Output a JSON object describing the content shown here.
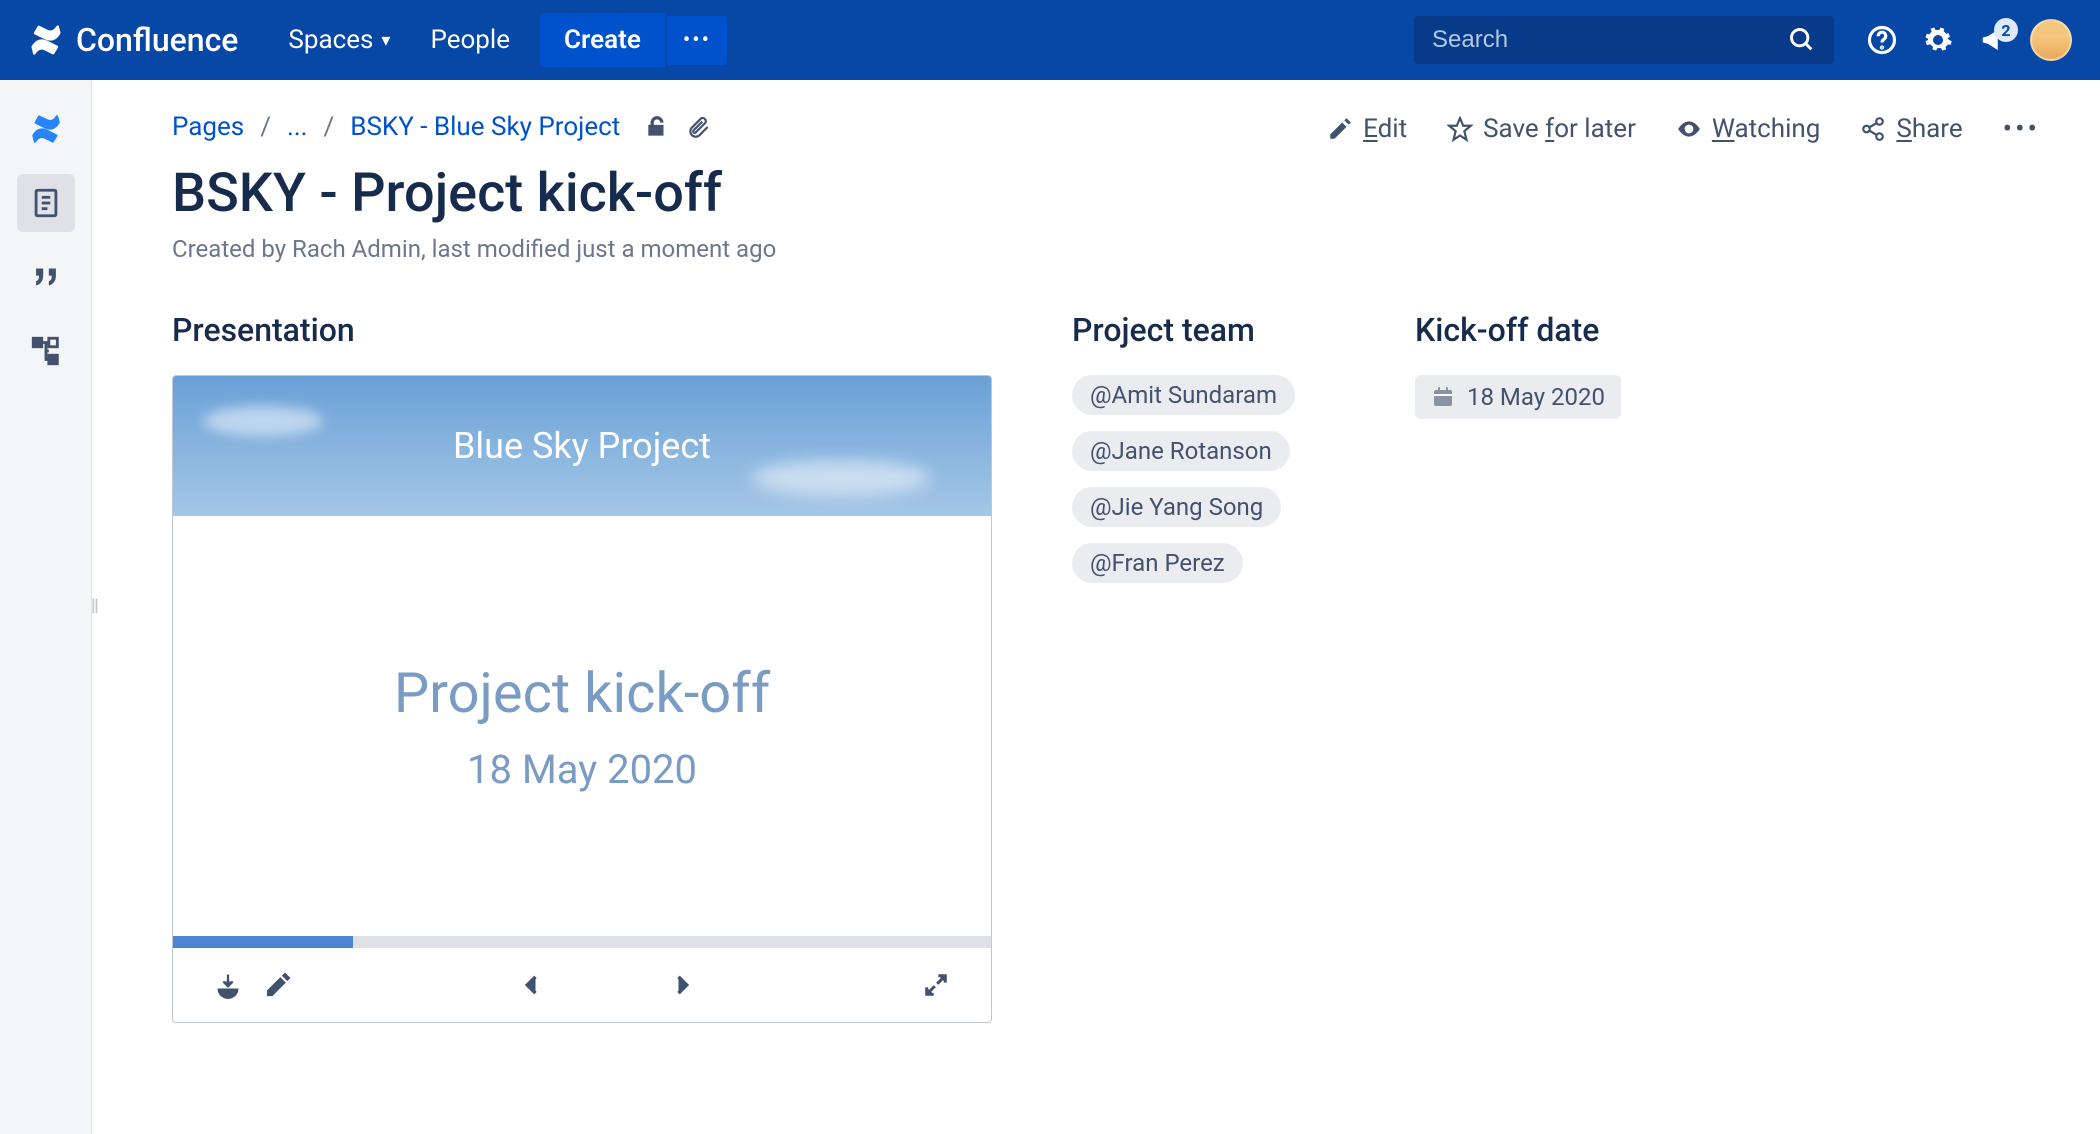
{
  "nav": {
    "brand": "Confluence",
    "spaces": "Spaces",
    "people": "People",
    "create": "Create",
    "search_placeholder": "Search",
    "notification_count": "2"
  },
  "crumbs": {
    "root": "Pages",
    "ellipsis": "...",
    "parent": "BSKY - Blue Sky Project"
  },
  "actions": {
    "edit_u": "E",
    "edit_rest": "dit",
    "save": "Save ",
    "save_u": "f",
    "save_rest": "or later",
    "watch_u": "W",
    "watch_rest": "atching",
    "share_u": "S",
    "share_rest": "hare"
  },
  "page": {
    "title": "BSKY - Project kick-off",
    "meta": "Created by Rach Admin, last modified just a moment ago"
  },
  "sections": {
    "presentation": "Presentation",
    "team": "Project team",
    "kickoff": "Kick-off date"
  },
  "presentation": {
    "banner": "Blue Sky Project",
    "main": "Project kick-off",
    "date": "18 May 2020"
  },
  "team": [
    "@Amit Sundaram",
    "@Jane Rotanson",
    "@Jie Yang Song",
    "@Fran Perez"
  ],
  "kickoff_date": "18 May 2020"
}
